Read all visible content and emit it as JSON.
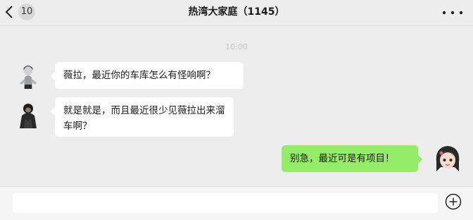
{
  "header": {
    "unread_count": "10",
    "title": "热湾大家庭（1145）"
  },
  "timestamp": "10:00",
  "messages": [
    {
      "side": "left",
      "avatar": "hooded-figure-avatar",
      "text": "薇拉，最近你的车库怎么有怪响啊？"
    },
    {
      "side": "left",
      "avatar": "dark-jacket-avatar",
      "text": "就是就是，而且最近很少见薇拉出来溜车啊？"
    },
    {
      "side": "right",
      "avatar": "anime-girl-avatar",
      "text": "别急，最近可是有项目！"
    }
  ],
  "input": {
    "value": "",
    "placeholder": ""
  },
  "colors": {
    "background": "#ededed",
    "incoming_bubble": "#ffffff",
    "outgoing_bubble": "#95ec69"
  },
  "icons": {
    "back": "back-chevron-icon",
    "more": "more-dots-icon",
    "plus": "plus-circle-icon"
  }
}
